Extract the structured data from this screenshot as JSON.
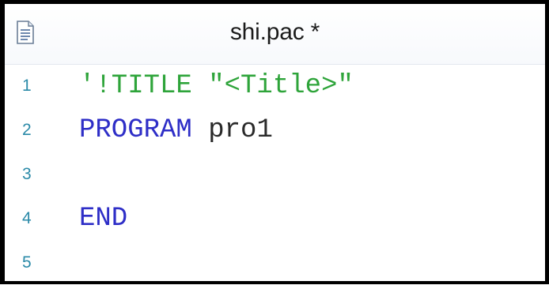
{
  "window": {
    "title": "shi.pac *",
    "icon": "document-icon"
  },
  "editor": {
    "lines": [
      {
        "number": "1",
        "segments": [
          {
            "text": "'!TITLE \"<Title>\"",
            "type": "comment"
          }
        ]
      },
      {
        "number": "2",
        "segments": [
          {
            "text": "PROGRAM",
            "type": "keyword"
          },
          {
            "text": " pro1",
            "type": "identifier"
          }
        ]
      },
      {
        "number": "3",
        "segments": []
      },
      {
        "number": "4",
        "segments": [
          {
            "text": "END",
            "type": "keyword"
          }
        ]
      },
      {
        "number": "5",
        "segments": []
      }
    ]
  },
  "colors": {
    "comment": "#2ea43a",
    "keyword": "#2e2ec7",
    "identifier": "#2a2a2a",
    "line_number": "#2b8aa8"
  }
}
